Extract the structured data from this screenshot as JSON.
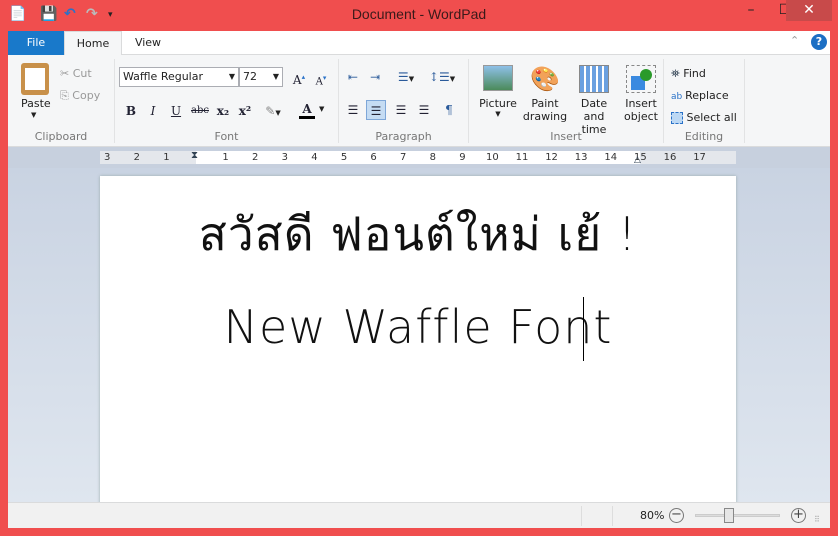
{
  "window": {
    "title": "Document - WordPad",
    "accent": "#f04e4e"
  },
  "quick_access": {
    "icons": [
      "app-icon",
      "save-icon",
      "undo-icon",
      "redo-icon",
      "customize-icon"
    ]
  },
  "tabs": [
    {
      "label": "File"
    },
    {
      "label": "Home"
    },
    {
      "label": "View"
    }
  ],
  "ribbon": {
    "clipboard": {
      "paste": "Paste",
      "cut": "Cut",
      "copy": "Copy",
      "label": "Clipboard"
    },
    "font": {
      "family": "Waffle Regular",
      "size": "72",
      "label": "Font",
      "buttons": [
        "B",
        "I",
        "U",
        "abc",
        "x₂",
        "x²"
      ]
    },
    "paragraph": {
      "label": "Paragraph"
    },
    "insert": {
      "picture": "Picture",
      "paint1": "Paint",
      "paint2": "drawing",
      "date1": "Date and",
      "date2": "time",
      "obj1": "Insert",
      "obj2": "object",
      "label": "Insert"
    },
    "editing": {
      "find": "Find",
      "replace": "Replace",
      "select_all": "Select all",
      "label": "Editing"
    }
  },
  "ruler": {
    "numbers": [
      "3",
      "2",
      "1",
      "1",
      "2",
      "3",
      "4",
      "5",
      "6",
      "7",
      "8",
      "9",
      "10",
      "11",
      "12",
      "13",
      "14",
      "15",
      "16",
      "17"
    ]
  },
  "document": {
    "line1": "สวัสดี ฟอนต์ใหม่ เย้ !",
    "line2": "New Waffle Font"
  },
  "status": {
    "zoom": "80%",
    "zoom_value": 80
  }
}
